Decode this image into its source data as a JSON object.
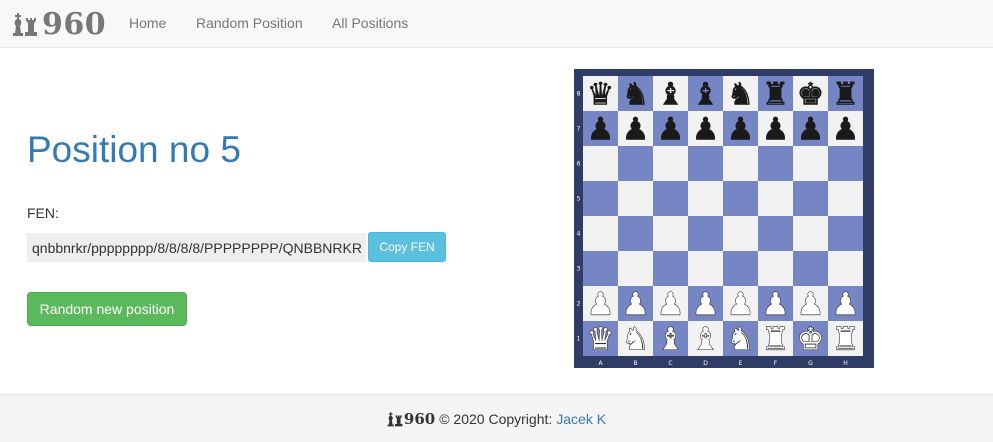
{
  "brand": {
    "text": "960"
  },
  "nav": {
    "items": [
      {
        "label": "Home"
      },
      {
        "label": "Random Position"
      },
      {
        "label": "All Positions"
      }
    ]
  },
  "main": {
    "title": "Position no 5",
    "fen_label": "FEN:",
    "fen_value": "qnbbnrkr/pppppppp/8/8/8/8/PPPPPPPP/QNBBNRKR",
    "copy_button": "Copy FEN",
    "random_button": "Random new position"
  },
  "board": {
    "ranks": [
      "8",
      "7",
      "6",
      "5",
      "4",
      "3",
      "2",
      "1"
    ],
    "files": [
      "A",
      "B",
      "C",
      "D",
      "E",
      "F",
      "G",
      "H"
    ],
    "rows": [
      [
        "q",
        "n",
        "b",
        "b",
        "n",
        "r",
        "k",
        "r"
      ],
      [
        "p",
        "p",
        "p",
        "p",
        "p",
        "p",
        "p",
        "p"
      ],
      [
        "",
        "",
        "",
        "",
        "",
        "",
        "",
        ""
      ],
      [
        "",
        "",
        "",
        "",
        "",
        "",
        "",
        ""
      ],
      [
        "",
        "",
        "",
        "",
        "",
        "",
        "",
        ""
      ],
      [
        "",
        "",
        "",
        "",
        "",
        "",
        "",
        ""
      ],
      [
        "P",
        "P",
        "P",
        "P",
        "P",
        "P",
        "P",
        "P"
      ],
      [
        "Q",
        "N",
        "B",
        "B",
        "N",
        "R",
        "K",
        "R"
      ]
    ],
    "colors": {
      "light": "#f2f2f2",
      "dark": "#7685c4",
      "frame": "#2f3d66",
      "label": "#ffffff"
    }
  },
  "footer": {
    "brand_text": "960",
    "copyright": "© 2020 Copyright:",
    "author": "Jacek K"
  }
}
